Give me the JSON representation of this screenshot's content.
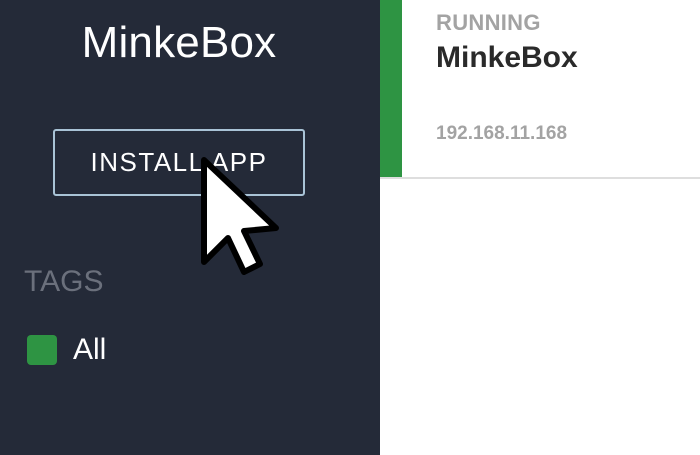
{
  "sidebar": {
    "app_title": "MinkeBox",
    "install_button_label": "INSTALL APP",
    "tags_heading": "TAGS",
    "tags": [
      {
        "label": "All",
        "color": "#2e9443"
      }
    ]
  },
  "app_card": {
    "status": "RUNNING",
    "name": "MinkeBox",
    "ip": "192.168.11.168",
    "status_color": "#2e9443"
  },
  "icons": {
    "cursor": "mouse-pointer-icon",
    "tag_swatch": "color-swatch-icon"
  },
  "colors": {
    "sidebar_bg": "#242a38",
    "button_border": "#a9c3d6",
    "accent_green": "#2e9443"
  }
}
